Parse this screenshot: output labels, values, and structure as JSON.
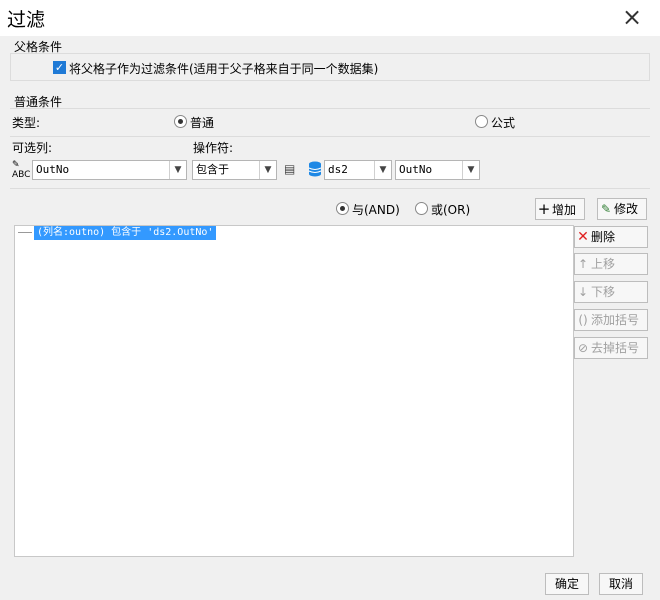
{
  "window": {
    "title": "过滤",
    "close_icon": "close-icon"
  },
  "parent_section": {
    "label": "父格条件",
    "checkbox_checked": true,
    "checkbox_label": "将父格子作为过滤条件(适用于父子格来自于同一个数据集)"
  },
  "normal_section": {
    "label": "普通条件",
    "type_label": "类型:",
    "radio_normal": "普通",
    "radio_formula": "公式",
    "selected_type": "普通",
    "column_label": "可选列:",
    "operator_label": "操作符:",
    "column_value": "OutNo",
    "operator_value": "包含于",
    "dataset_value": "ds2",
    "field_value": "OutNo"
  },
  "logic": {
    "and_label": "与(AND)",
    "or_label": "或(OR)",
    "selected": "与(AND)",
    "add_button": "增加",
    "modify_button": "修改"
  },
  "conditions": {
    "items": [
      "(列名:outno) 包含于 'ds2.OutNo'"
    ]
  },
  "side_buttons": {
    "delete": "删除",
    "move_up": "上移",
    "move_down": "下移",
    "add_bracket": "添加括号",
    "remove_bracket": "去掉括号"
  },
  "footer": {
    "ok": "确定",
    "cancel": "取消"
  },
  "colors": {
    "accent": "#1f7ad6",
    "selection": "#3399ff",
    "delete_red": "#e02020",
    "db_blue": "#1e88e5"
  }
}
